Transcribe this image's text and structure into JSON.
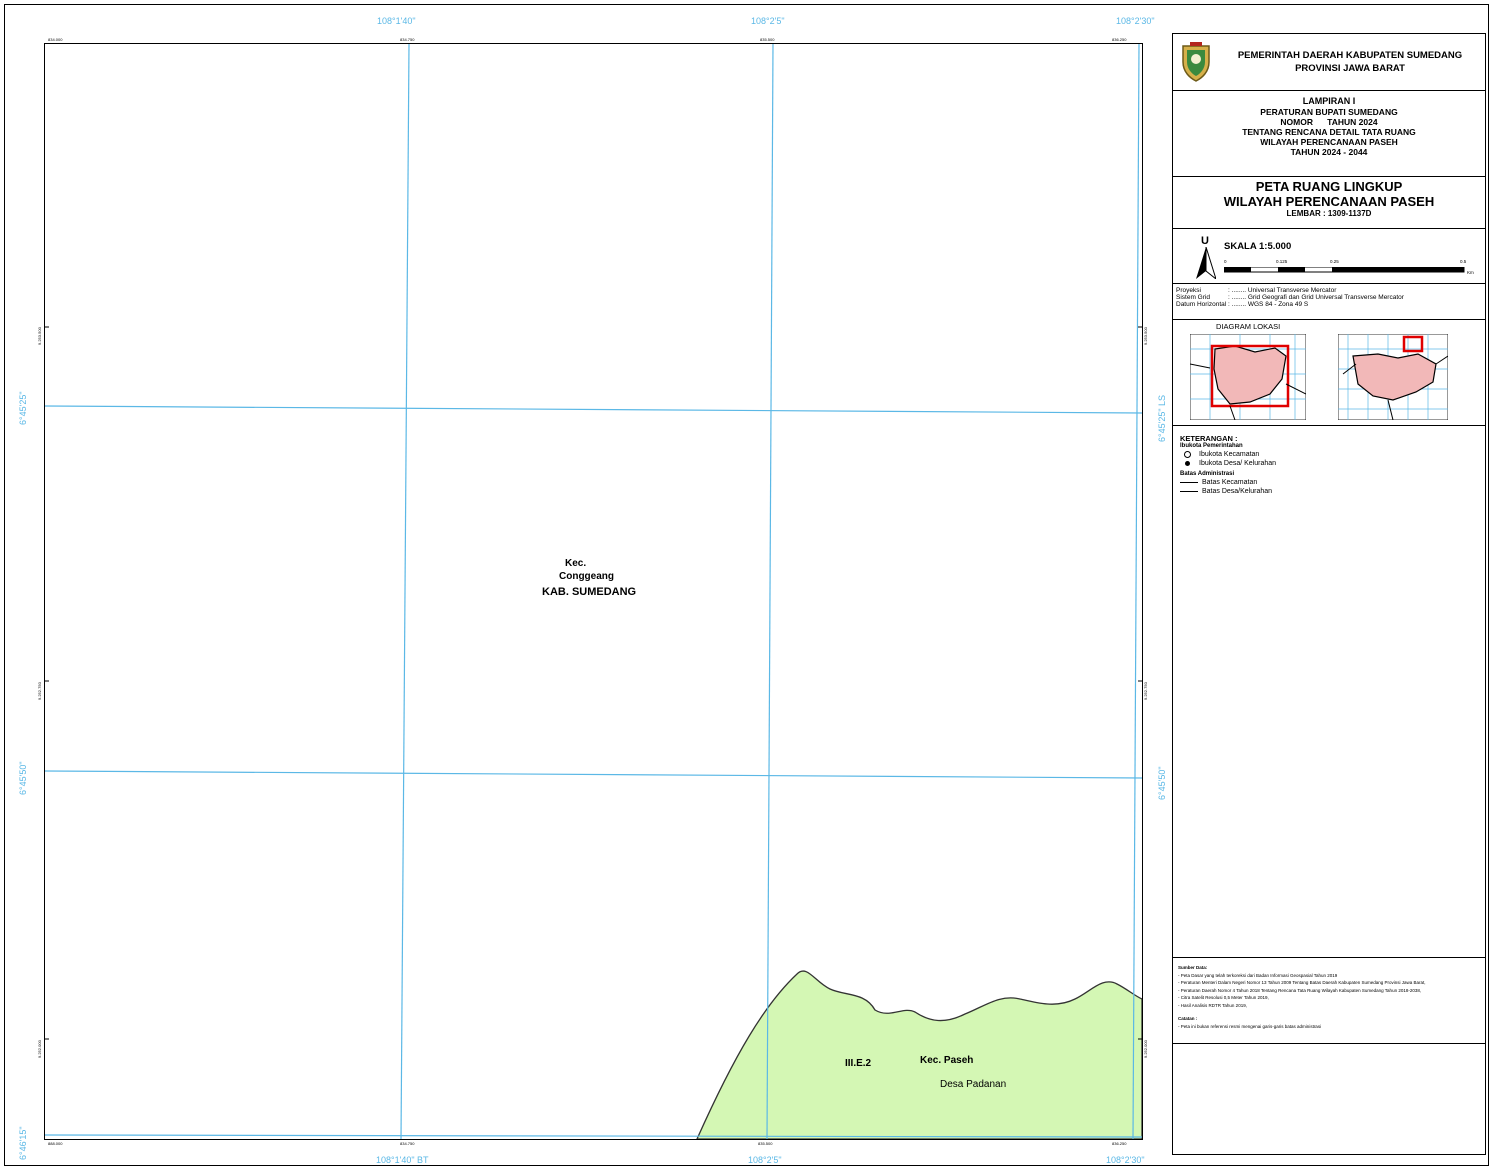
{
  "grid": {
    "top_lon": [
      "108°1'40\"",
      "108°2'5\"",
      "108°2'30\""
    ],
    "bottom_lon": [
      "108°1'40\" BT",
      "108°2'5\"",
      "108°2'30\""
    ],
    "left_lat": [
      "6°45'25\"",
      "6°45'50\"",
      "6°46'15\""
    ],
    "right_lat": [
      "6°45'25\" LS",
      "6°45'50\""
    ],
    "top_ticks": [
      "834.000",
      "834.750",
      "835.500",
      "836.250"
    ],
    "bottom_ticks": [
      "888.000",
      "834.750",
      "835.500",
      "836.250"
    ],
    "left_ticks": [
      "9.253.500",
      "9.252.750",
      "9.252.000"
    ],
    "right_ticks": [
      "9.253.500",
      "9.252.750",
      "9.252.000"
    ]
  },
  "map": {
    "label_kec_conggeang_1": "Kec.",
    "label_kec_conggeang_2": "Conggeang",
    "label_kab": "KAB. SUMEDANG",
    "label_zone": "III.E.2",
    "label_kec_paseh": "Kec. Paseh",
    "label_desa": "Desa Padanan",
    "colors": {
      "grid": "#5bb8e6",
      "area": "#d4f7b4"
    }
  },
  "header": {
    "line1": "PEMERINTAH DAERAH KABUPATEN SUMEDANG",
    "line2": "PROVINSI JAWA BARAT"
  },
  "lampiran": {
    "title": "LAMPIRAN I",
    "line1": "PERATURAN BUPATI SUMEDANG",
    "line2": "NOMOR      TAHUN 2024",
    "line3": "TENTANG RENCANA DETAIL TATA RUANG",
    "line4": "WILAYAH PERENCANAAN PASEH",
    "line5": "TAHUN 2024 - 2044"
  },
  "map_title": {
    "line1": "PETA RUANG LINGKUP",
    "line2": "WILAYAH PERENCANAAN PASEH",
    "sheet": "LEMBAR : 1309-1137D"
  },
  "scale": {
    "north": "U",
    "label": "SKALA 1:5.000",
    "ticks": [
      "0",
      "0.125",
      "0.25",
      "0.5"
    ],
    "unit": "Km"
  },
  "projection": {
    "rows": [
      {
        "k": "Proyeksi",
        "v": ": ........ Universal Transverse Mercator"
      },
      {
        "k": "Sistem Grid",
        "v": ": ........ Grid Geografi dan Grid Universal Transverse Mercator"
      },
      {
        "k": "Datum Horizontal",
        "v": ": ........ WGS 84 - Zona 49 S"
      }
    ]
  },
  "diagram": {
    "title": "DIAGRAM LOKASI"
  },
  "legend": {
    "title": "KETERANGAN :",
    "sub1": "Ibukota Pemerintahan",
    "item1": "Ibukota Kecamatan",
    "item2": "Ibukota Desa/ Kelurahan",
    "sub2": "Batas Administrasi",
    "item3": "Batas Kecamatan",
    "item4": "Batas Desa/Kelurahan"
  },
  "sources": {
    "title": "Sumber Data:",
    "lines": [
      "- Peta Dasar yang telah terkoreksi dari Badan Informasi Geospasial Tahun 2019",
      "- Peraturan Menteri Dalam Negeri Nomor 13 Tahun 2009 Tentang Batas Daerah Kabupaten Sumedang Provinsi Jawa Barat,",
      "- Peraturan Daerah Nomor 4 Tahun 2018 Tentang Rencana Tata Ruang Wilayah Kabupaten Sumedang Tahun 2018-2038,",
      "- Citra Satelit Resolusi 0,5 Meter Tahun 2019,",
      "- Hasil Analisis RDTR Tahun 2019,"
    ],
    "note_title": "Catatan :",
    "note": "- Peta ini bukan referensi resmi mengenai garis-garis batas administrasi"
  }
}
